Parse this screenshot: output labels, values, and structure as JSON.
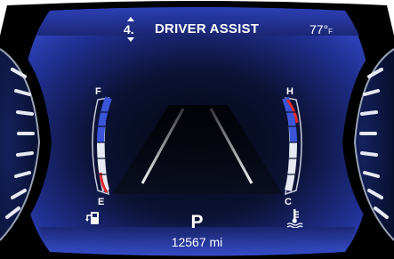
{
  "header": {
    "page_number": "4.",
    "title": "DRIVER ASSIST",
    "temperature": "77°",
    "temperature_unit": "F"
  },
  "fuel_gauge": {
    "full_label": "F",
    "empty_label": "E",
    "icon": "fuel-pump-icon",
    "level": 0.85
  },
  "coolant_gauge": {
    "hot_label": "H",
    "cold_label": "C",
    "icon": "coolant-temperature-icon",
    "level": 0.7
  },
  "status": {
    "gear": "P",
    "odometer": "12567 mi"
  },
  "colors": {
    "accent_blue": "#3a55d8",
    "warning_red": "#e0282e",
    "text": "#ffffff",
    "background_black": "#000000"
  }
}
